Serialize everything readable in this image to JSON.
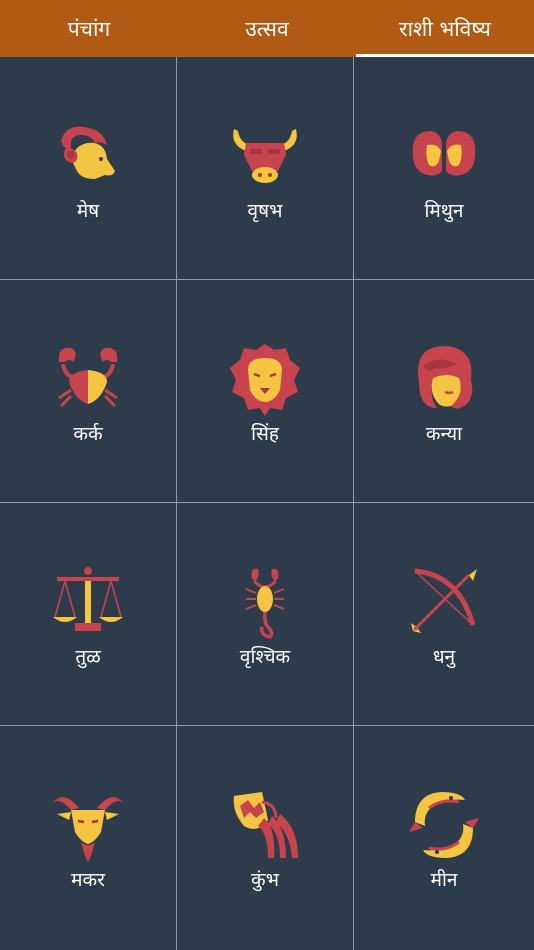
{
  "tabs": [
    {
      "label": "पंचांग"
    },
    {
      "label": "उत्सव"
    },
    {
      "label": "राशी भविष्य"
    }
  ],
  "active_tab": 2,
  "colors": {
    "header": "#b15a14",
    "background": "#2d3b4a",
    "icon_red": "#c7444f",
    "icon_yellow": "#f4c542"
  },
  "signs": [
    {
      "label": "मेष",
      "icon": "aries-ram-icon"
    },
    {
      "label": "वृषभ",
      "icon": "taurus-bull-icon"
    },
    {
      "label": "मिथुन",
      "icon": "gemini-twins-icon"
    },
    {
      "label": "कर्क",
      "icon": "cancer-crab-icon"
    },
    {
      "label": "सिंह",
      "icon": "leo-lion-icon"
    },
    {
      "label": "कन्या",
      "icon": "virgo-maiden-icon"
    },
    {
      "label": "तुळ",
      "icon": "libra-scales-icon"
    },
    {
      "label": "वृश्चिक",
      "icon": "scorpio-scorpion-icon"
    },
    {
      "label": "धनु",
      "icon": "sagittarius-bow-icon"
    },
    {
      "label": "मकर",
      "icon": "capricorn-goat-icon"
    },
    {
      "label": "कुंभ",
      "icon": "aquarius-pot-icon"
    },
    {
      "label": "मीन",
      "icon": "pisces-fish-icon"
    }
  ]
}
